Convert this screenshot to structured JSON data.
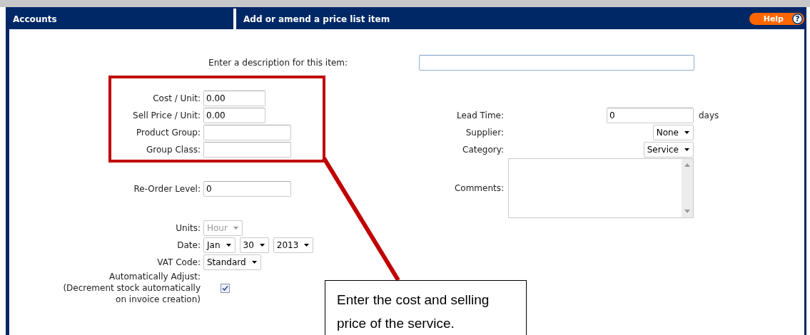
{
  "header": {
    "section": "Accounts",
    "title": "Add or amend a price list item",
    "help": {
      "label": "Help",
      "glyph": "?"
    }
  },
  "description": {
    "label": "Enter a description for this item:"
  },
  "left_groups": [
    [
      {
        "kind": "amount",
        "label": "Cost / Unit:",
        "value": "0.00"
      },
      {
        "kind": "amount",
        "label": "Sell Price / Unit:",
        "value": "0.00"
      },
      {
        "kind": "text",
        "label": "Product Group:"
      },
      {
        "kind": "text",
        "label": "Group Class:"
      }
    ],
    [
      {
        "kind": "text",
        "label": "Re-Order Level:",
        "value": "0"
      }
    ],
    [
      {
        "kind": "select",
        "label": "Units:",
        "options": [
          "Hour"
        ],
        "disabled": true
      },
      {
        "kind": "select",
        "label": "Date:",
        "options": [
          "Jan",
          "30",
          "2013"
        ],
        "disabled": false
      },
      {
        "kind": "select",
        "label": "VAT Code:",
        "options": [
          "Standard"
        ],
        "disabled": false
      },
      {
        "kind": "checkbox",
        "label": "Automatically Adjust:\n(Decrement stock automatically\non invoice creation)",
        "checked": true
      }
    ]
  ],
  "right_fields": [
    {
      "kind": "text",
      "label": "Lead Time:",
      "value": "0",
      "suffix": "days"
    },
    {
      "kind": "select",
      "label": "Supplier:",
      "options": [
        "None"
      ],
      "disabled": false
    },
    {
      "kind": "select",
      "label": "Category:",
      "options": [
        "Service"
      ],
      "disabled": false
    },
    {
      "kind": "textarea",
      "label": "Comments:"
    }
  ],
  "annotation": {
    "note": "Enter the cost and selling price of the service."
  }
}
